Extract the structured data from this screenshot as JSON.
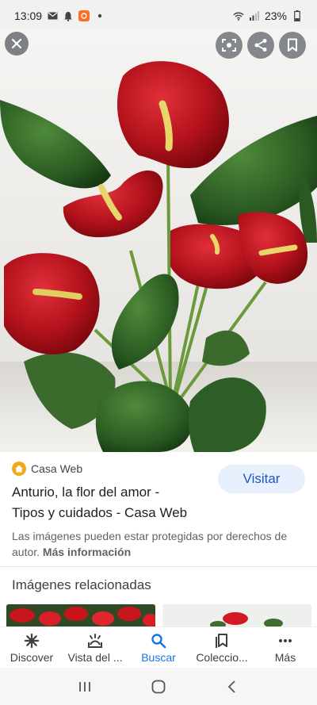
{
  "status_bar": {
    "time": "13:09",
    "battery": "23%",
    "left_icons": [
      "mail-icon",
      "bell-icon",
      "app-notification-icon",
      "dot-icon"
    ],
    "right_icons": [
      "wifi-icon",
      "signal-icon",
      "battery-icon"
    ]
  },
  "viewer": {
    "close_icon": "close-icon",
    "actions": [
      "lens-icon",
      "share-icon",
      "bookmark-icon"
    ]
  },
  "result": {
    "source": "Casa Web",
    "title_line1": "Anturio, la flor del amor -",
    "title_line2": "Tipos y cuidados - Casa Web",
    "visit_label": "Visitar",
    "copyright_text": "Las imágenes pueden estar protegidas por derechos de autor.",
    "more_info": "Más información"
  },
  "related": {
    "title": "Imágenes relacionadas"
  },
  "bottom_nav": {
    "items": [
      {
        "label": "Discover",
        "icon": "asterisk-icon"
      },
      {
        "label": "Vista del ...",
        "icon": "snapshot-icon"
      },
      {
        "label": "Buscar",
        "icon": "search-icon"
      },
      {
        "label": "Coleccio...",
        "icon": "collections-icon"
      },
      {
        "label": "Más",
        "icon": "more-icon"
      }
    ],
    "active": "Buscar",
    "active_color": "#1a73e8"
  },
  "system_nav": [
    "recents-icon",
    "home-icon",
    "back-icon"
  ]
}
